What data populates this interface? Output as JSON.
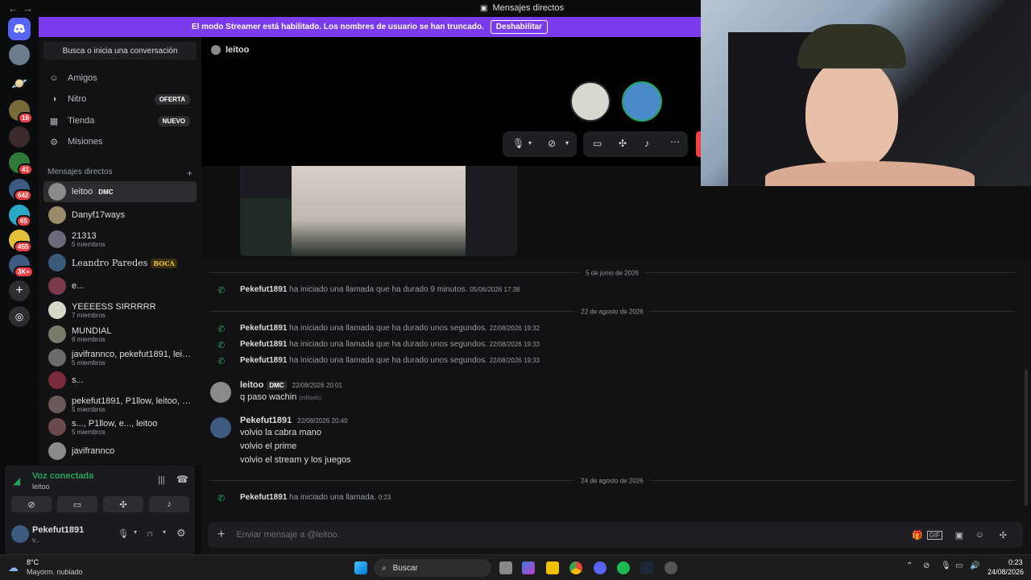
{
  "window": {
    "title": "Mensajes directos"
  },
  "banner": {
    "text": "El modo Streamer está habilitado. Los nombres de usuario se han truncado.",
    "button": "Deshabilitar"
  },
  "servers": [
    {
      "badge": ""
    },
    {
      "badge": ""
    },
    {
      "badge": "16"
    },
    {
      "badge": ""
    },
    {
      "badge": "41"
    },
    {
      "badge": "642"
    },
    {
      "badge": "65"
    },
    {
      "badge": "455"
    },
    {
      "badge": "3K+"
    }
  ],
  "sidebar": {
    "search_placeholder": "Busca o inicia una conversación",
    "nav": [
      {
        "label": "Amigos",
        "icon": "friends-icon",
        "pill": ""
      },
      {
        "label": "Nitro",
        "icon": "nitro-icon",
        "pill": "OFERTA"
      },
      {
        "label": "Tienda",
        "icon": "shop-icon",
        "pill": "NUEVO"
      },
      {
        "label": "Misiones",
        "icon": "quests-icon",
        "pill": ""
      }
    ],
    "dm_header": "Mensajes directos",
    "dms": [
      {
        "name": "leitoo",
        "tag": "DMC",
        "sub": ""
      },
      {
        "name": "Danyf17ways",
        "tag": "",
        "sub": ""
      },
      {
        "name": "21313",
        "tag": "",
        "sub": "5 miembros"
      },
      {
        "name": "Leandro Paredes",
        "tag": "BOCA",
        "sub": ""
      },
      {
        "name": "e...",
        "tag": "",
        "sub": ""
      },
      {
        "name": "YEEEESS SIRRRRR",
        "tag": "",
        "sub": "7 miembros"
      },
      {
        "name": "MUNDIAL",
        "tag": "",
        "sub": "6 miembros"
      },
      {
        "name": "javifrannco, pekefut1891, leitoo,...",
        "tag": "",
        "sub": "5 miembros"
      },
      {
        "name": "s...",
        "tag": "",
        "sub": ""
      },
      {
        "name": "pekefut1891, P1llow, leitoo, e...",
        "tag": "",
        "sub": "5 miembros"
      },
      {
        "name": "s..., P1llow, e..., leitoo",
        "tag": "",
        "sub": "5 miembros"
      },
      {
        "name": "javifrannco",
        "tag": "",
        "sub": ""
      }
    ]
  },
  "voice": {
    "status": "Voz conectada",
    "channel": "leitoo"
  },
  "user": {
    "name": "Pekefut1891",
    "status": "v..."
  },
  "channel": {
    "name": "leitoo"
  },
  "messages": {
    "sep1": "5 de junio de 2026",
    "call1": {
      "user": "Pekefut1891",
      "text": "ha iniciado una llamada que ha durado 9 minutos.",
      "ts": "05/06/2026 17:38"
    },
    "sep2": "22 de agosto de 2026",
    "call2": {
      "user": "Pekefut1891",
      "text": "ha iniciado una llamada que ha durado unos segundos.",
      "ts": "22/08/2026 19:32"
    },
    "call3": {
      "user": "Pekefut1891",
      "text": "ha iniciado una llamada que ha durado unos segundos.",
      "ts": "22/08/2026 19:33"
    },
    "call4": {
      "user": "Pekefut1891",
      "text": "ha iniciado una llamada que ha durado unos segundos.",
      "ts": "22/08/2026 19:33"
    },
    "m1": {
      "user": "leitoo",
      "tag": "DMC",
      "ts": "22/08/2026 20:01",
      "line1": "q paso wachin",
      "edited": "(editado)"
    },
    "m2": {
      "user": "Pekefut1891",
      "ts": "22/08/2026 20:40",
      "line1": "volvio la cabra mano",
      "line2": "volvio el prime",
      "line3": "volvio el stream y los juegos"
    },
    "sep3": "24 de agosto de 2026",
    "call5": {
      "user": "Pekefut1891",
      "text": "ha iniciado una llamada.",
      "ts": "0:23"
    }
  },
  "composer": {
    "placeholder": "Enviar mensaje a @leitoo"
  },
  "taskbar": {
    "weather_temp": "8°C",
    "weather_desc": "Mayorm. nublado",
    "search": "Buscar",
    "time": "0:23",
    "date": "24/08/2026"
  },
  "colors": {
    "accent": "#7c3aed",
    "online": "#23a55a",
    "danger": "#f23f43"
  }
}
